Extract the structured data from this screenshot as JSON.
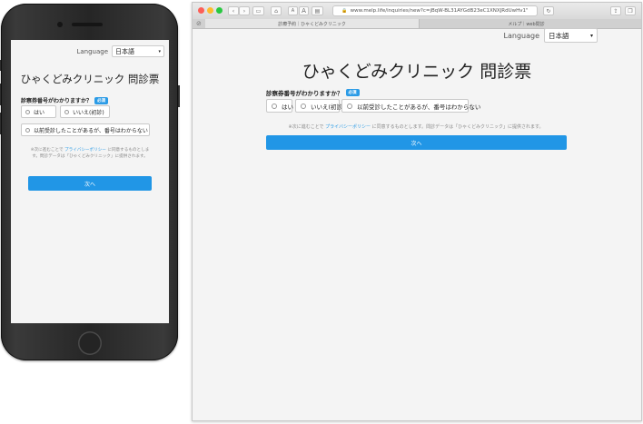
{
  "form": {
    "language_label": "Language",
    "language_value": "日本語",
    "title": "ひゃくどみクリニック 問診票",
    "question": "診察券番号がわかりますか？",
    "required_badge": "必須",
    "options": [
      "はい",
      "いいえ(初診)",
      "以前受診したことがあるが、番号はわからない"
    ],
    "note_prefix": "※次に進むことで",
    "privacy_link": "プライバシーポリシー",
    "note_suffix": "に同意するものとします。問診データは「ひゃくどみクリニック」に提供されます。",
    "next_button": "次へ"
  },
  "browser": {
    "address": "www.melp.life/inquiries/new?c=jBqW-BL31AYGdB23eC1XNXJRdUwHv1\"",
    "tabs": [
      "診療予約｜ひゃくどみクリニック",
      "メルプ｜web問診"
    ],
    "font_small": "A",
    "font_large": "A"
  },
  "colors": {
    "accent": "#2196e6",
    "close": "#fc5f57",
    "minimize": "#fdbc2e",
    "zoom": "#28c840"
  }
}
